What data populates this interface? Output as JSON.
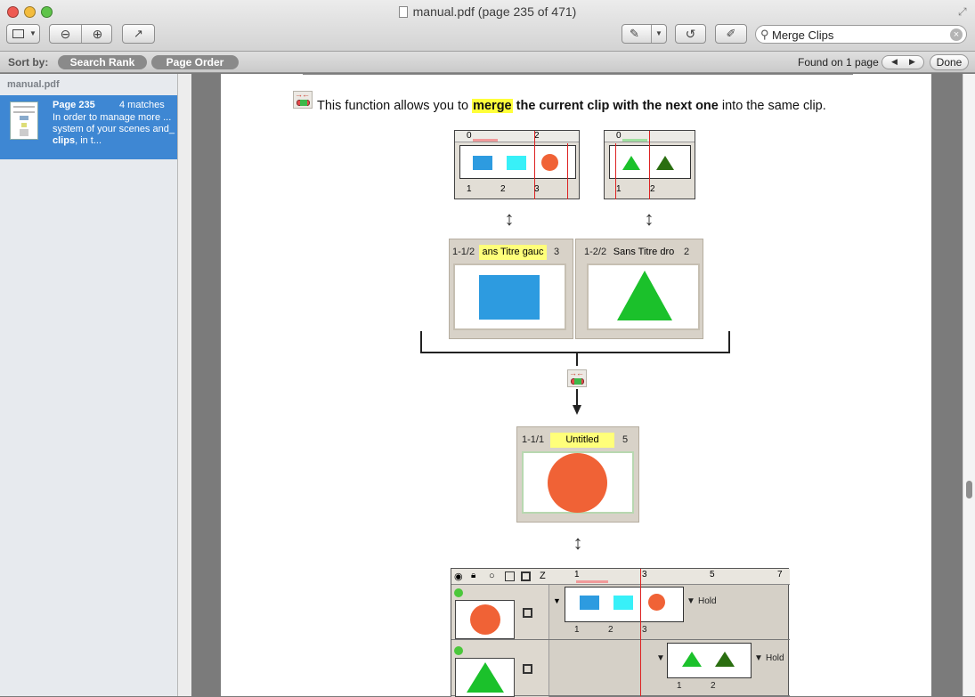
{
  "window": {
    "title": "manual.pdf (page 235 of 471)"
  },
  "toolbar": {
    "search_value": "Merge Clips",
    "search_placeholder": "Search"
  },
  "sortbar": {
    "sort_label": "Sort by:",
    "search_rank": "Search Rank",
    "page_order": "Page Order",
    "found_text": "Found on 1 page",
    "done": "Done"
  },
  "sidebar": {
    "file_name": "manual.pdf",
    "result": {
      "page": "Page 235",
      "matches": "4 matches",
      "snippet_pre": "In order to manage more ... system of your scenes and_ ",
      "snippet_bold": "clips",
      "snippet_post": ", in t..."
    }
  },
  "document": {
    "sentence_pre": "This function allows you to ",
    "sentence_highlight": "merge",
    "sentence_bold": " the current clip with the next one",
    "sentence_post": " into the same clip.",
    "tl_left": {
      "r0": "0",
      "r2": "2",
      "n1": "1",
      "n2": "2",
      "n3": "3"
    },
    "tl_right": {
      "r0": "0",
      "n1": "1",
      "n2": "2"
    },
    "card_left": {
      "id": "1-1/2",
      "title": "ans Titre gauc",
      "count": "3"
    },
    "card_right": {
      "id": "1-2/2",
      "title": "Sans Titre dro",
      "count": "2"
    },
    "card_merged": {
      "id": "1-1/1",
      "title": "Untitled",
      "count": "5"
    },
    "big_tl": {
      "z": "Z",
      "r1": "1",
      "r3": "3",
      "r5": "5",
      "r7": "7",
      "hold": "Hold",
      "t1n1": "1",
      "t1n2": "2",
      "t1n3": "3",
      "t2n1": "1",
      "t2n2": "2"
    }
  },
  "colors": {
    "blue": "#2d9be0",
    "cyan": "#38f0f8",
    "orange": "#f06236",
    "green": "#1bc12b",
    "darkgreen": "#2a6e10",
    "highlight": "#ffff3a",
    "selection": "#3e87d3"
  }
}
